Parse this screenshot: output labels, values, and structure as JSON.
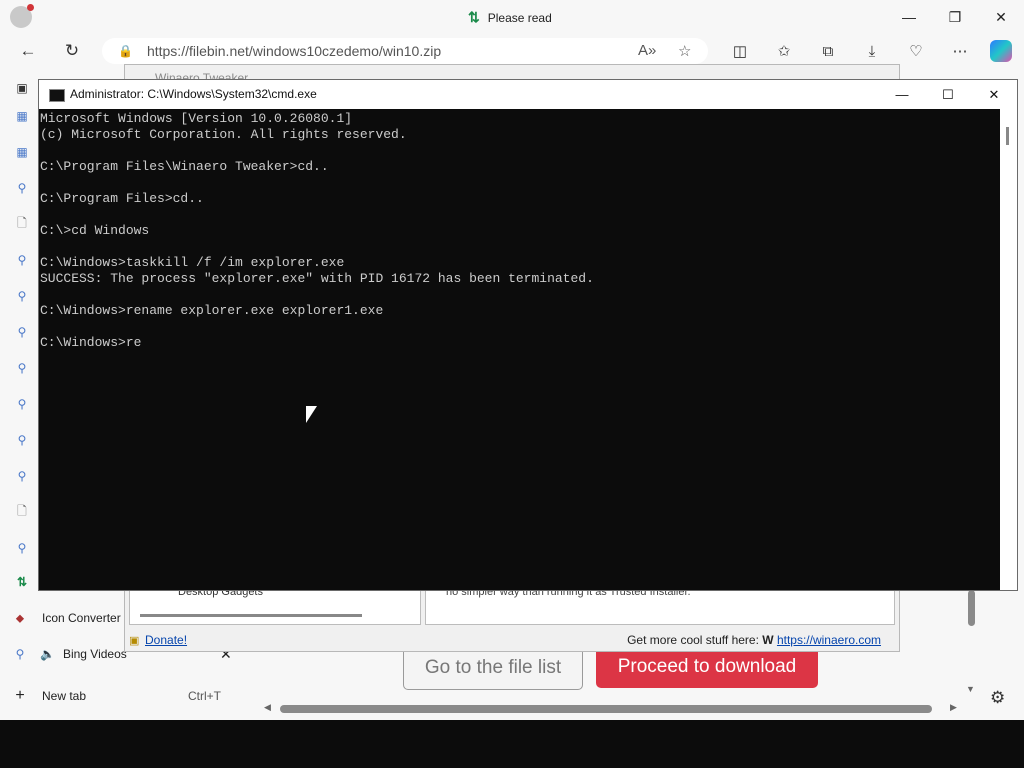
{
  "browser": {
    "tab_title": "Please read",
    "url": "https://filebin.net/windows10czedemo/win10.zip"
  },
  "tabs_panel": {
    "items": [
      {
        "label": "Icon Converter -"
      },
      {
        "label": "Bing Videos"
      },
      {
        "label": "New tab",
        "shortcut": "Ctrl+T"
      }
    ]
  },
  "page": {
    "go_to_list_label": "Go to the file list",
    "proceed_label": "Proceed to download"
  },
  "tweaker": {
    "title": "Winaero Tweaker",
    "tree_item": "Desktop Gadgets",
    "description": "no simpler way than running it as Trusted Installer.",
    "donate_label": "Donate!",
    "getmore_label": "Get more cool stuff here:",
    "link_label": "https://winaero.com"
  },
  "cmd": {
    "title": "Administrator: C:\\Windows\\System32\\cmd.exe",
    "lines": [
      "Microsoft Windows [Version 10.0.26080.1]",
      "(c) Microsoft Corporation. All rights reserved.",
      "",
      "C:\\Program Files\\Winaero Tweaker>cd..",
      "",
      "C:\\Program Files>cd..",
      "",
      "C:\\>cd Windows",
      "",
      "C:\\Windows>taskkill /f /im explorer.exe",
      "SUCCESS: The process \"explorer.exe\" with PID 16172 has been terminated.",
      "",
      "C:\\Windows>rename explorer.exe explorer1.exe",
      "",
      "C:\\Windows>re"
    ]
  }
}
